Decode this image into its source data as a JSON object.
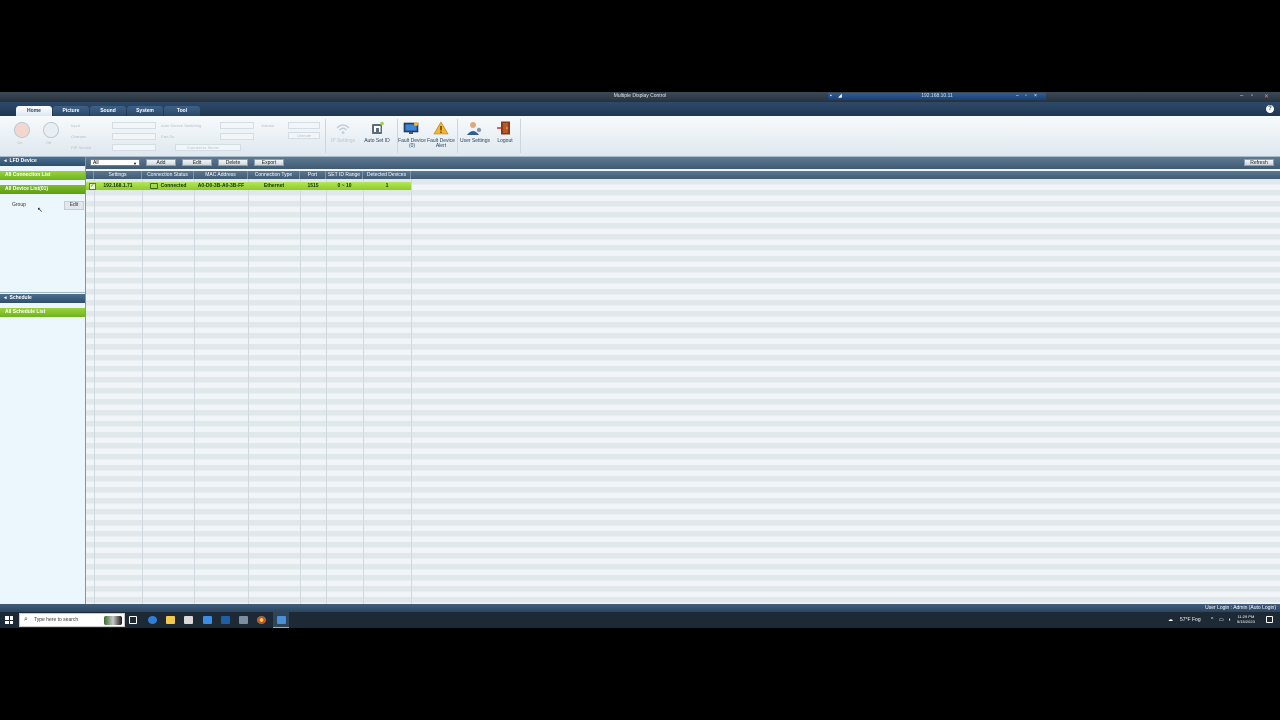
{
  "window": {
    "title": "Multiple Display Control",
    "remote_ip": "192.168.10.11",
    "help_glyph": "?"
  },
  "tabs": [
    "Home",
    "Picture",
    "Sound",
    "System",
    "Tool"
  ],
  "ribbon": {
    "disabled_labels": [
      "Input",
      "Channel",
      "PIP Source",
      "Auto Source Switching",
      "Fan On",
      "Volume"
    ],
    "disabled_button": "Connect to Server",
    "disabled_small": "Unmute",
    "btn_labels": [
      "On",
      "Off"
    ],
    "wifi_label": "IP Settings",
    "auto_set_id": "Auto Set ID",
    "fault_device": "Fault Device (0)",
    "fault_device_alert": "Fault Device Alert",
    "user_settings": "User Settings",
    "logout": "Logout"
  },
  "left_panel": {
    "lfd_header": "LFD Device",
    "all_connection_list": "All Connection List",
    "all_device_list": "All Device List(01)",
    "group_label": "Group",
    "edit_button": "Edit",
    "schedule_header": "Schedule",
    "all_schedule_list": "All Schedule List"
  },
  "toolbar": {
    "filter_value": "All",
    "add": "Add",
    "edit": "Edit",
    "delete": "Delete",
    "export": "Export",
    "refresh": "Refresh"
  },
  "table": {
    "columns": [
      "Settings",
      "Connection Status",
      "MAC Address",
      "Connection Type",
      "Port",
      "SET ID Range",
      "Detected Devices"
    ],
    "rows": [
      {
        "settings": "192.168.1.71",
        "connection_status": "Connected",
        "mac_address": "A0-D0-3B-A0-3B-FF",
        "connection_type": "Ethernet",
        "port": "1515",
        "set_id_range": "0 ~ 10",
        "detected_devices": "1",
        "checked": true
      }
    ]
  },
  "status_bar": {
    "text": "User Login : Admin (Auto Login)"
  },
  "taskbar": {
    "search_placeholder": "Type here to search",
    "weather": "57°F  Fog",
    "time": "11:29 PM",
    "date": "5/15/2023"
  }
}
